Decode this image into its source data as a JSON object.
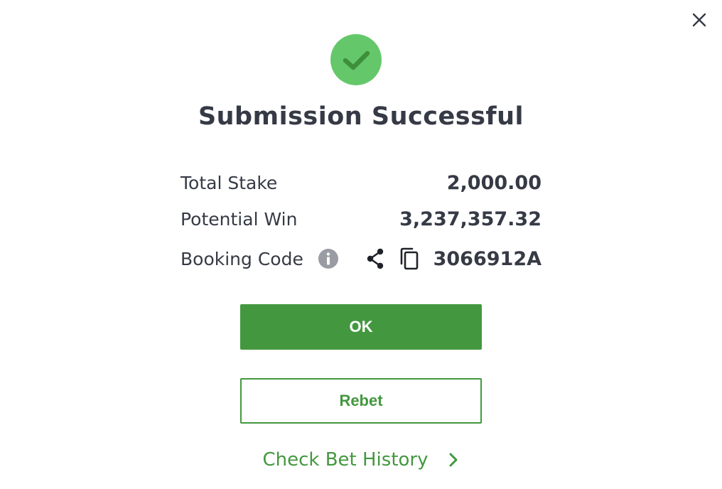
{
  "dialog": {
    "title": "Submission Successful",
    "close_icon": "close-icon",
    "success_icon": "check-circle-icon"
  },
  "summary": {
    "total_stake": {
      "label": "Total Stake",
      "value": "2,000.00"
    },
    "potential_win": {
      "label": "Potential Win",
      "value": "3,237,357.32"
    },
    "booking_code": {
      "label": "Booking Code",
      "value": "3066912A",
      "icons": [
        "info-icon",
        "share-icon",
        "copy-icon"
      ]
    }
  },
  "buttons": {
    "ok_label": "OK",
    "rebet_label": "Rebet"
  },
  "history_link": {
    "label": "Check Bet History",
    "icon": "chevron-right-icon"
  },
  "colors": {
    "accent": "#43983f",
    "success_circle": "#64c86a",
    "check_mark": "#3e8f3c",
    "text": "#353a45",
    "icon_gray": "#9a9ca4"
  }
}
